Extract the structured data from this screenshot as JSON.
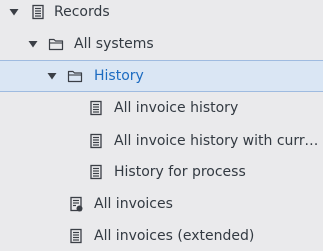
{
  "tree": {
    "records": {
      "label": "Records",
      "expanded": true
    },
    "all_systems": {
      "label": "All systems",
      "expanded": true
    },
    "history": {
      "label": "History",
      "expanded": true,
      "selected": true
    },
    "all_invoice_history": {
      "label": "All invoice history"
    },
    "all_invoice_history_currency": {
      "label": "All invoice history with curre..."
    },
    "history_for_process": {
      "label": "History for process"
    },
    "all_invoices": {
      "label": "All invoices"
    },
    "all_invoices_extended": {
      "label": "All invoices (extended)"
    }
  },
  "colors": {
    "background": "#eaeaec",
    "selection_background": "#dae6f4",
    "selection_border": "#9fbbe0",
    "selection_text": "#1c6bc1",
    "text": "#333a42",
    "icon": "#3b3f46"
  },
  "icons": {
    "expand": "triangle-down-icon",
    "folder": "folder-icon",
    "report": "document-list-icon",
    "report_alt": "document-gear-icon"
  }
}
